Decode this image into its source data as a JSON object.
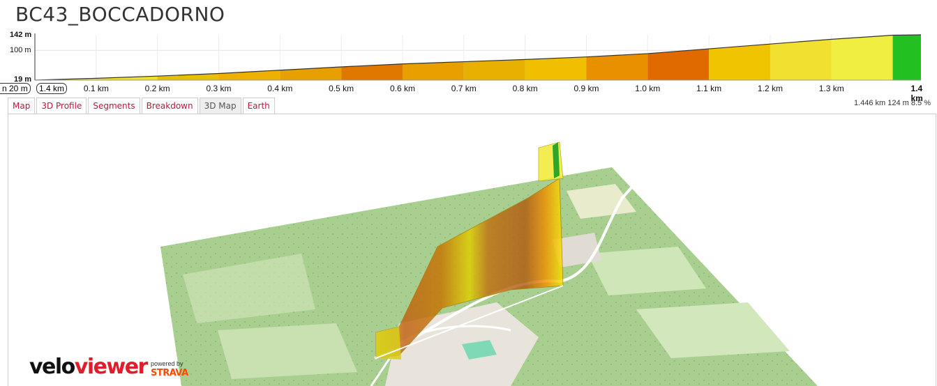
{
  "title": "BC43_BOCCADORNO",
  "profile": {
    "y_labels": {
      "top": "142 m",
      "mid": "100 m",
      "bottom": "19 m"
    },
    "hover_left": "n 20 m",
    "hover_km": "1.4 km",
    "x_labels": [
      "0.1 km",
      "0.2 km",
      "0.3 km",
      "0.4 km",
      "0.5 km",
      "0.6 km",
      "0.7 km",
      "0.8 km",
      "0.9 km",
      "1.0 km",
      "1.1 km",
      "1.2 km",
      "1.3 km",
      "1.4 km"
    ]
  },
  "chart_data": {
    "type": "area",
    "xlabel": "",
    "ylabel": "",
    "ylim": [
      19,
      142
    ],
    "xlim": [
      0,
      1.446
    ],
    "x": [
      0,
      0.1,
      0.2,
      0.3,
      0.4,
      0.5,
      0.6,
      0.7,
      0.8,
      0.9,
      1.0,
      1.1,
      1.2,
      1.3,
      1.4,
      1.446
    ],
    "elevation": [
      19,
      24,
      30,
      37,
      46,
      55,
      63,
      69,
      75,
      82,
      91,
      104,
      117,
      130,
      141,
      142
    ],
    "gradient_colors": [
      "#f2e12a",
      "#f0e020",
      "#e8c000",
      "#f0b000",
      "#e8a000",
      "#e07800",
      "#e8a000",
      "#e8b000",
      "#f0c000",
      "#e89000",
      "#e06a00",
      "#f0c400",
      "#f2e030",
      "#f0ee40",
      "#22c020"
    ]
  },
  "tabs": [
    "Map",
    "3D Profile",
    "Segments",
    "Breakdown",
    "3D Map",
    "Earth"
  ],
  "active_tab": "3D Map",
  "stats": "1.446 km 124 m 8.5 %",
  "branding": {
    "logo_a": "velo",
    "logo_b": "viewer",
    "powered": "powered by",
    "strava": "STRAVA"
  }
}
